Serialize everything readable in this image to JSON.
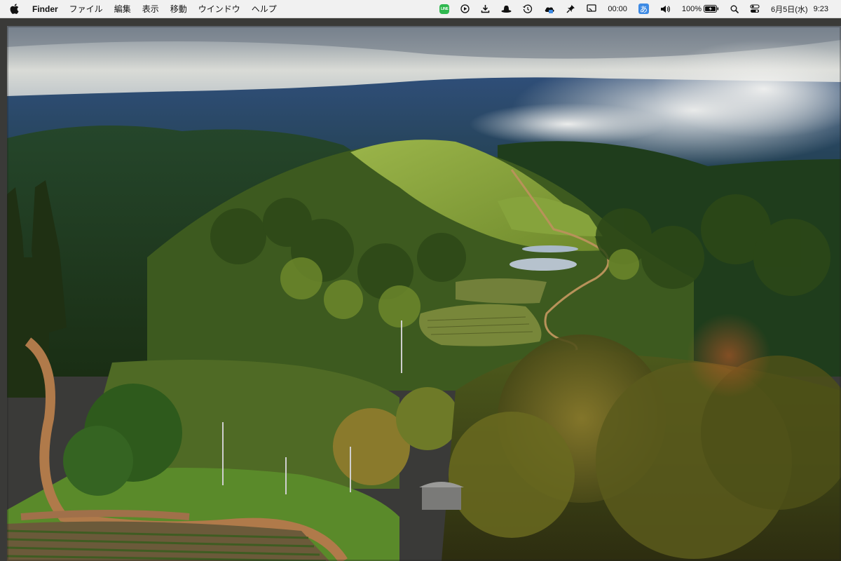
{
  "menubar": {
    "app_name": "Finder",
    "menus": [
      "ファイル",
      "編集",
      "表示",
      "移動",
      "ウインドウ",
      "ヘルプ"
    ],
    "status": {
      "line_label": "LINE",
      "timer": "00:00",
      "ime": "あ",
      "battery": "100%",
      "date": "6月5日(水)",
      "time": "9:23"
    },
    "icons": [
      "apple-icon",
      "line-icon",
      "play-icon",
      "download-icon",
      "hat-icon",
      "time-machine-icon",
      "cloud-icon",
      "pin-icon",
      "screen-mirror-icon",
      "volume-icon",
      "battery-icon",
      "search-icon",
      "control-center-icon"
    ]
  },
  "desktop": {
    "wallpaper": "landscape-photo"
  }
}
